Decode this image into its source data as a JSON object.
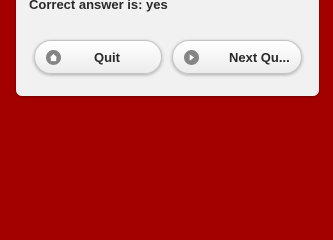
{
  "result": {
    "answer_text": "Correct answer is: yes"
  },
  "buttons": {
    "quit_label": "Quit",
    "next_label": "Next Qu...",
    "quit_icon": "home-icon",
    "next_icon": "arrow-right-icon"
  },
  "colors": {
    "background": "#a30000",
    "panel": "#f1f1f1",
    "icon": "#858585",
    "text": "#2a2a2a"
  }
}
